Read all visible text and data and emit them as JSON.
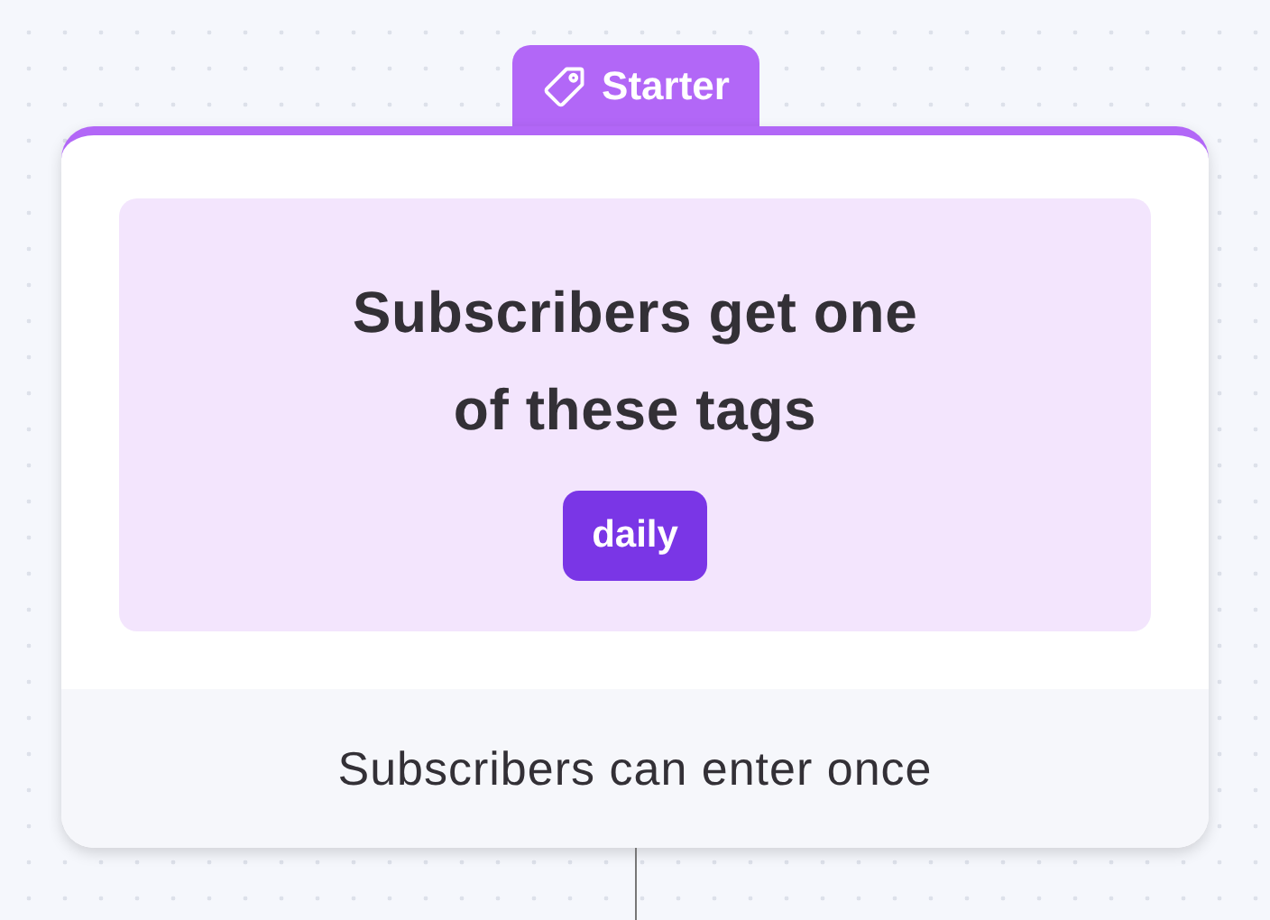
{
  "node": {
    "label": "Starter",
    "heading_lines": [
      "Subscribers get one",
      "of these tags"
    ],
    "tags": [
      {
        "label": "daily"
      }
    ],
    "footer": "Subscribers can enter once"
  }
}
